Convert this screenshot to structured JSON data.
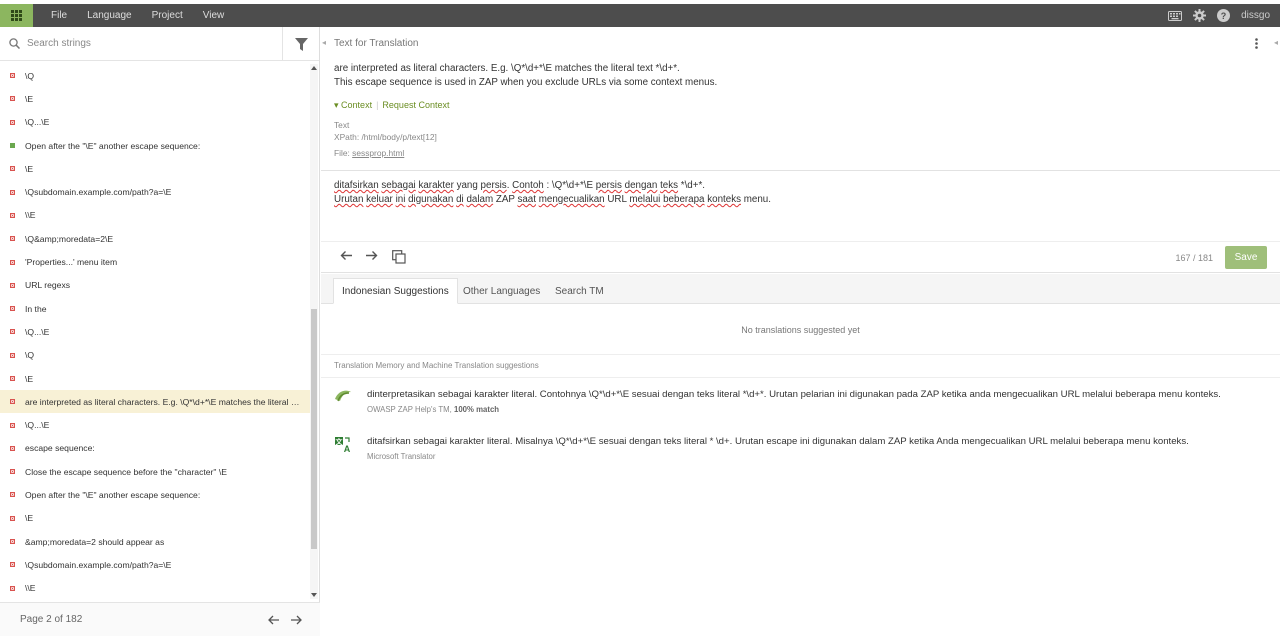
{
  "menu": {
    "file": "File",
    "language": "Language",
    "project": "Project",
    "view": "View"
  },
  "user": "dissgo",
  "search": {
    "placeholder": "Search strings"
  },
  "strings": [
    {
      "text": "\\Q",
      "status": "red"
    },
    {
      "text": "\\E",
      "status": "red"
    },
    {
      "text": "\\Q...\\E",
      "status": "red"
    },
    {
      "text": "Open after the \"\\E\" another escape sequence:",
      "status": "green"
    },
    {
      "text": "\\E",
      "status": "red"
    },
    {
      "text": "\\Qsubdomain.example.com/path?a=\\E",
      "status": "red"
    },
    {
      "text": "\\\\E",
      "status": "red"
    },
    {
      "text": "\\Q&amp;moredata=2\\E",
      "status": "red"
    },
    {
      "text": "'Properties...' menu item",
      "status": "red"
    },
    {
      "text": "URL regexs",
      "status": "red"
    },
    {
      "text": "In the",
      "status": "red"
    },
    {
      "text": "\\Q...\\E",
      "status": "red"
    },
    {
      "text": "\\Q",
      "status": "red"
    },
    {
      "text": "\\E",
      "status": "red"
    },
    {
      "text": "are interpreted as literal characters. E.g. \\Q*\\d+*\\E matches the literal text *\\d+*.",
      "status": "red",
      "selected": true
    },
    {
      "text": "\\Q...\\E",
      "status": "red"
    },
    {
      "text": "escape sequence:",
      "status": "red"
    },
    {
      "text": "Close the escape sequence before the \"character\" \\E",
      "status": "red"
    },
    {
      "text": "Open after the \"\\E\" another escape sequence:",
      "status": "red"
    },
    {
      "text": "\\E",
      "status": "red"
    },
    {
      "text": "&amp;moredata=2 should appear as",
      "status": "red"
    },
    {
      "text": "\\Qsubdomain.example.com/path?a=\\E",
      "status": "red"
    },
    {
      "text": "\\\\E",
      "status": "red"
    }
  ],
  "pager": {
    "label": "Page 2 of 182"
  },
  "source": {
    "header": "Text for Translation",
    "line1": "are interpreted as literal characters. E.g. \\Q*\\d+*\\E matches the literal text *\\d+*.",
    "line2": "This escape sequence is used in ZAP when you exclude URLs via some context menus."
  },
  "context": {
    "label": "Context",
    "request": "Request Context",
    "type": "Text",
    "xpath": "XPath: /html/body/p/text[12]",
    "file_prefix": "File: ",
    "file": "sessprop.html"
  },
  "translation": {
    "l1": [
      "ditafsirkan",
      " ",
      "sebagai",
      " ",
      "karakter",
      " yang ",
      "persis",
      ". ",
      "Contoh",
      " : \\Q*\\d+*\\E ",
      "persis",
      " ",
      "dengan",
      " ",
      "teks",
      " *\\d+*."
    ],
    "l2": [
      "Urutan",
      " ",
      "keluar",
      " ",
      "ini",
      " ",
      "digunakan",
      " ",
      "di",
      " ",
      "dalam",
      " ZAP ",
      "saat",
      " ",
      "mengecualikan",
      " URL ",
      "melalui",
      " ",
      "beberapa",
      " ",
      "konteks",
      " menu."
    ]
  },
  "counter": "167 / 181",
  "save": "Save",
  "tabs": [
    "Indonesian Suggestions",
    "Other Languages",
    "Search TM"
  ],
  "no_suggestions": "No translations suggested yet",
  "tm_label": "Translation Memory and Machine Translation suggestions",
  "suggestions": [
    {
      "text": "dinterpretasikan sebagai karakter literal. Contohnya \\Q*\\d+*\\E sesuai dengan teks literal *\\d+*. Urutan pelarian ini digunakan pada ZAP ketika anda mengecualikan URL melalui beberapa menu konteks.",
      "source": "OWASP ZAP Help's TM, ",
      "match": "100% match"
    },
    {
      "text": "ditafsirkan sebagai karakter literal. Misalnya \\Q*\\d+*\\E sesuai dengan teks literal * \\d+. Urutan escape ini digunakan dalam ZAP ketika Anda mengecualikan URL melalui beberapa menu konteks.",
      "source": "Microsoft Translator",
      "match": ""
    }
  ]
}
